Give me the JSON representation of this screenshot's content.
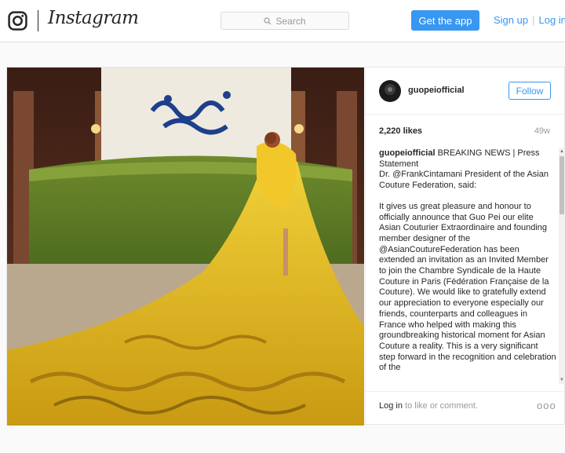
{
  "nav": {
    "wordmark": "Instagram",
    "search_placeholder": "Search",
    "get_app_label": "Get the app",
    "signup_label": "Sign up",
    "separator": "|",
    "login_label": "Log in",
    "icons": {
      "logo": "instagram-camera-icon",
      "search": "search-icon"
    }
  },
  "post": {
    "username": "guopeiofficial",
    "follow_label": "Follow",
    "likes": "2,220 likes",
    "age": "49w",
    "caption": {
      "username": "guopeiofficial",
      "lead": "BREAKING NEWS | Press Statement",
      "line2": "Dr. @FrankCintamani President of the Asian Couture Federation, said:",
      "body": "It gives us great pleasure and honour to officially announce that Guo Pei our elite Asian Couturier Extraordinaire and founding member designer of the @AsianCoutureFederation has been extended an invitation as an Invited Member to join the Chambre Syndicale de la Haute Couture in Paris (Fédération Française de la Couture). We would like to gratefully extend our appreciation to everyone especially our friends, counterparts and colleagues in France who helped with making this groundbreaking historical moment for Asian Couture a reality. This is a very significant step forward in the recognition and celebration of the"
    },
    "footer": {
      "login_link": "Log in",
      "login_rest": " to like or comment.",
      "more": "ooo"
    }
  },
  "colors": {
    "accent": "#3897f0",
    "border": "#dbdbdb",
    "text": "#262626",
    "muted": "#999999",
    "background": "#fafafa"
  }
}
